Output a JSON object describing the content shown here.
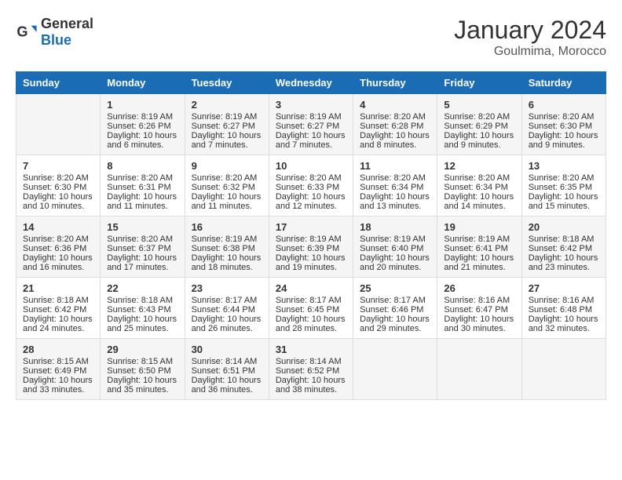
{
  "header": {
    "logo_general": "General",
    "logo_blue": "Blue",
    "month_year": "January 2024",
    "location": "Goulmima, Morocco"
  },
  "days_of_week": [
    "Sunday",
    "Monday",
    "Tuesday",
    "Wednesday",
    "Thursday",
    "Friday",
    "Saturday"
  ],
  "weeks": [
    [
      {
        "day": "",
        "content": ""
      },
      {
        "day": "1",
        "content": "Sunrise: 8:19 AM\nSunset: 6:26 PM\nDaylight: 10 hours and 6 minutes."
      },
      {
        "day": "2",
        "content": "Sunrise: 8:19 AM\nSunset: 6:27 PM\nDaylight: 10 hours and 7 minutes."
      },
      {
        "day": "3",
        "content": "Sunrise: 8:19 AM\nSunset: 6:27 PM\nDaylight: 10 hours and 7 minutes."
      },
      {
        "day": "4",
        "content": "Sunrise: 8:20 AM\nSunset: 6:28 PM\nDaylight: 10 hours and 8 minutes."
      },
      {
        "day": "5",
        "content": "Sunrise: 8:20 AM\nSunset: 6:29 PM\nDaylight: 10 hours and 9 minutes."
      },
      {
        "day": "6",
        "content": "Sunrise: 8:20 AM\nSunset: 6:30 PM\nDaylight: 10 hours and 9 minutes."
      }
    ],
    [
      {
        "day": "7",
        "content": "Sunrise: 8:20 AM\nSunset: 6:30 PM\nDaylight: 10 hours and 10 minutes."
      },
      {
        "day": "8",
        "content": "Sunrise: 8:20 AM\nSunset: 6:31 PM\nDaylight: 10 hours and 11 minutes."
      },
      {
        "day": "9",
        "content": "Sunrise: 8:20 AM\nSunset: 6:32 PM\nDaylight: 10 hours and 11 minutes."
      },
      {
        "day": "10",
        "content": "Sunrise: 8:20 AM\nSunset: 6:33 PM\nDaylight: 10 hours and 12 minutes."
      },
      {
        "day": "11",
        "content": "Sunrise: 8:20 AM\nSunset: 6:34 PM\nDaylight: 10 hours and 13 minutes."
      },
      {
        "day": "12",
        "content": "Sunrise: 8:20 AM\nSunset: 6:34 PM\nDaylight: 10 hours and 14 minutes."
      },
      {
        "day": "13",
        "content": "Sunrise: 8:20 AM\nSunset: 6:35 PM\nDaylight: 10 hours and 15 minutes."
      }
    ],
    [
      {
        "day": "14",
        "content": "Sunrise: 8:20 AM\nSunset: 6:36 PM\nDaylight: 10 hours and 16 minutes."
      },
      {
        "day": "15",
        "content": "Sunrise: 8:20 AM\nSunset: 6:37 PM\nDaylight: 10 hours and 17 minutes."
      },
      {
        "day": "16",
        "content": "Sunrise: 8:19 AM\nSunset: 6:38 PM\nDaylight: 10 hours and 18 minutes."
      },
      {
        "day": "17",
        "content": "Sunrise: 8:19 AM\nSunset: 6:39 PM\nDaylight: 10 hours and 19 minutes."
      },
      {
        "day": "18",
        "content": "Sunrise: 8:19 AM\nSunset: 6:40 PM\nDaylight: 10 hours and 20 minutes."
      },
      {
        "day": "19",
        "content": "Sunrise: 8:19 AM\nSunset: 6:41 PM\nDaylight: 10 hours and 21 minutes."
      },
      {
        "day": "20",
        "content": "Sunrise: 8:18 AM\nSunset: 6:42 PM\nDaylight: 10 hours and 23 minutes."
      }
    ],
    [
      {
        "day": "21",
        "content": "Sunrise: 8:18 AM\nSunset: 6:42 PM\nDaylight: 10 hours and 24 minutes."
      },
      {
        "day": "22",
        "content": "Sunrise: 8:18 AM\nSunset: 6:43 PM\nDaylight: 10 hours and 25 minutes."
      },
      {
        "day": "23",
        "content": "Sunrise: 8:17 AM\nSunset: 6:44 PM\nDaylight: 10 hours and 26 minutes."
      },
      {
        "day": "24",
        "content": "Sunrise: 8:17 AM\nSunset: 6:45 PM\nDaylight: 10 hours and 28 minutes."
      },
      {
        "day": "25",
        "content": "Sunrise: 8:17 AM\nSunset: 6:46 PM\nDaylight: 10 hours and 29 minutes."
      },
      {
        "day": "26",
        "content": "Sunrise: 8:16 AM\nSunset: 6:47 PM\nDaylight: 10 hours and 30 minutes."
      },
      {
        "day": "27",
        "content": "Sunrise: 8:16 AM\nSunset: 6:48 PM\nDaylight: 10 hours and 32 minutes."
      }
    ],
    [
      {
        "day": "28",
        "content": "Sunrise: 8:15 AM\nSunset: 6:49 PM\nDaylight: 10 hours and 33 minutes."
      },
      {
        "day": "29",
        "content": "Sunrise: 8:15 AM\nSunset: 6:50 PM\nDaylight: 10 hours and 35 minutes."
      },
      {
        "day": "30",
        "content": "Sunrise: 8:14 AM\nSunset: 6:51 PM\nDaylight: 10 hours and 36 minutes."
      },
      {
        "day": "31",
        "content": "Sunrise: 8:14 AM\nSunset: 6:52 PM\nDaylight: 10 hours and 38 minutes."
      },
      {
        "day": "",
        "content": ""
      },
      {
        "day": "",
        "content": ""
      },
      {
        "day": "",
        "content": ""
      }
    ]
  ]
}
